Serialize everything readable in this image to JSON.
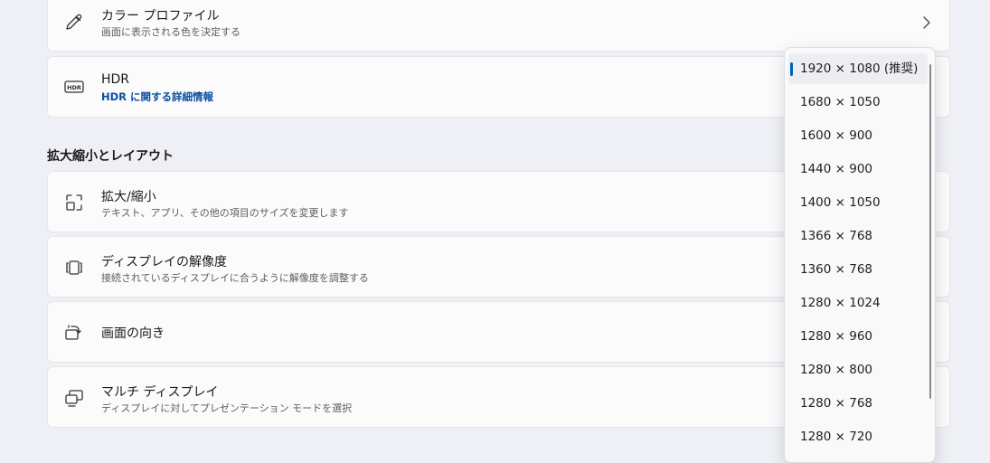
{
  "color_profile": {
    "title": "カラー プロファイル",
    "description": "画面に表示される色を決定する",
    "icon": "eyedropper-icon"
  },
  "hdr": {
    "title": "HDR",
    "link": "HDR に関する詳細情報",
    "icon": "hdr-icon"
  },
  "section": {
    "title": "拡大縮小とレイアウト"
  },
  "scale": {
    "title": "拡大/縮小",
    "description": "テキスト、アプリ、その他の項目のサイズを変更します",
    "icon": "scale-icon"
  },
  "resolution": {
    "title": "ディスプレイの解像度",
    "description": "接続されているディスプレイに合うように解像度を調整する",
    "icon": "resolution-icon"
  },
  "orientation": {
    "title": "画面の向き",
    "icon": "orientation-icon"
  },
  "multi_display": {
    "title": "マルチ ディスプレイ",
    "description": "ディスプレイに対してプレゼンテーション モードを選択",
    "icon": "multi-display-icon"
  },
  "resolution_dropdown": {
    "selected": "1920 × 1080 (推奨)",
    "options": [
      "1920 × 1080 (推奨)",
      "1680 × 1050",
      "1600 × 900",
      "1440 × 900",
      "1400 × 1050",
      "1366 × 768",
      "1360 × 768",
      "1280 × 1024",
      "1280 × 960",
      "1280 × 800",
      "1280 × 768",
      "1280 × 720"
    ],
    "accent_color": "#005fb8"
  }
}
